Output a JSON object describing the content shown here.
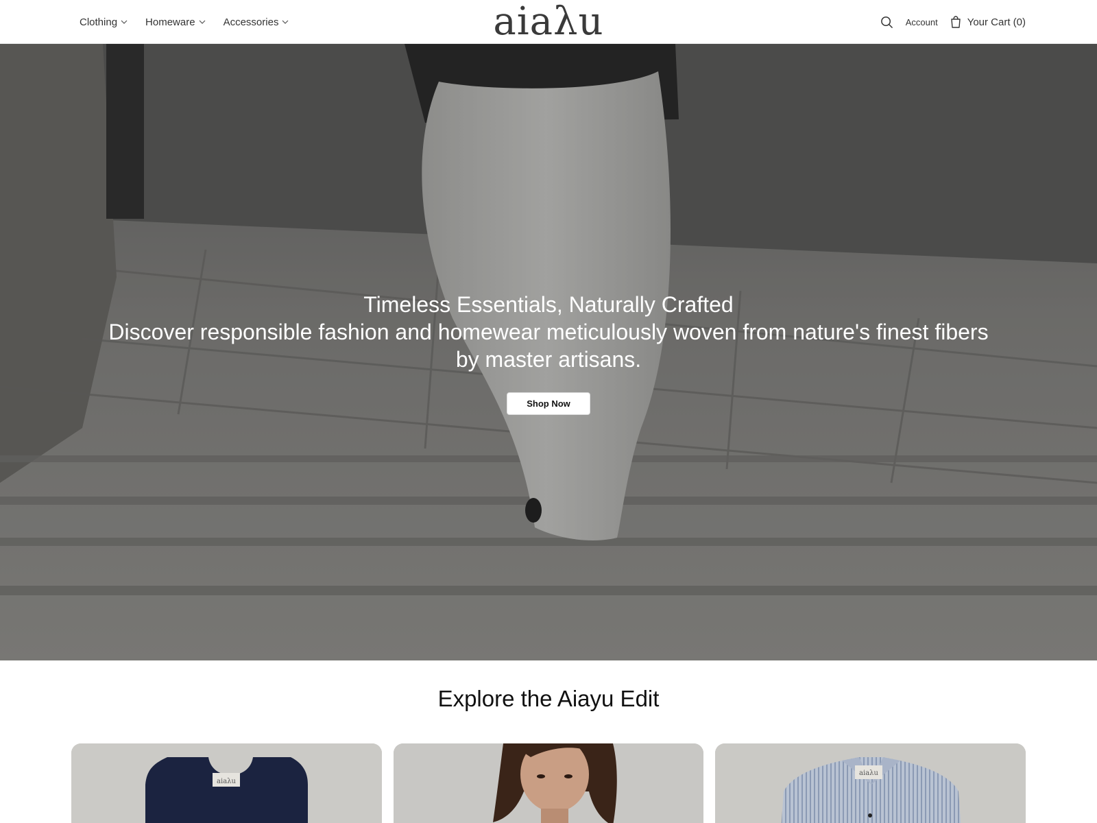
{
  "header": {
    "nav": [
      {
        "label": "Clothing"
      },
      {
        "label": "Homeware"
      },
      {
        "label": "Accessories"
      }
    ],
    "logo": "aiaλu",
    "search_icon": "search-icon",
    "account_label": "Account",
    "cart_label": "Your Cart (0)",
    "cart_icon": "shopping-bag-icon"
  },
  "hero": {
    "title": "Timeless Essentials, Naturally Crafted",
    "subtitle": "Discover responsible fashion and homewear meticulously woven from nature's finest fibers by master artisans.",
    "cta": "Shop Now"
  },
  "edit": {
    "title": "Explore the Aiayu Edit",
    "cards": [
      {
        "label_tag": "aiaλu"
      },
      {
        "label_tag": ""
      },
      {
        "label_tag": "aiaλu"
      }
    ]
  },
  "colors": {
    "text": "#333333",
    "hero_text": "#ffffff",
    "card_bg": "#c9c8c4"
  }
}
